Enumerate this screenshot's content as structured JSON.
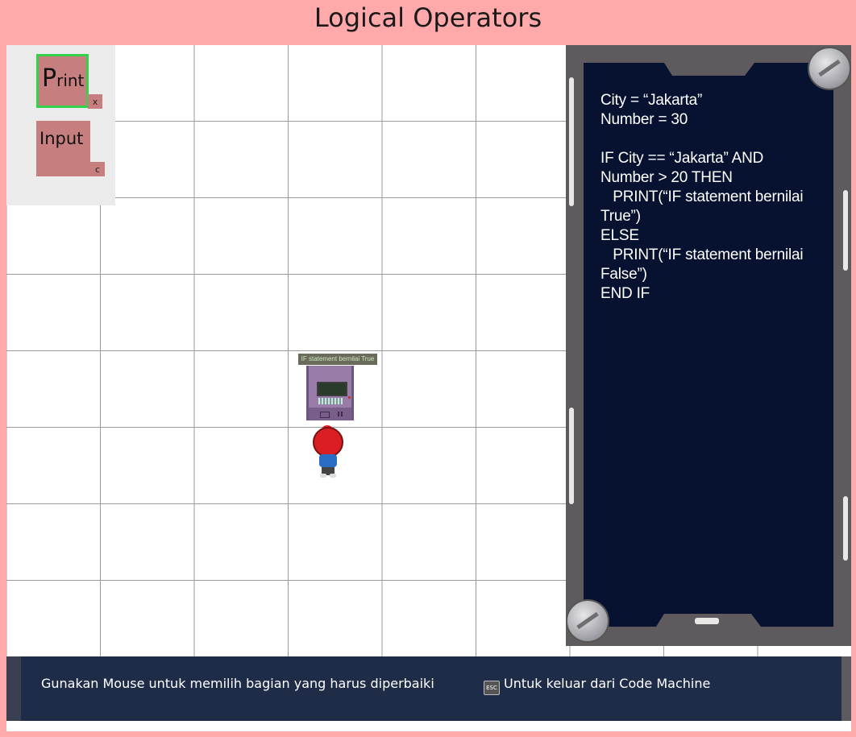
{
  "header": {
    "title": "Logical Operators"
  },
  "palette": {
    "items": [
      {
        "label_first": "P",
        "label_rest": "rint",
        "key": "x",
        "selected": true
      },
      {
        "label": "Input",
        "key": "c",
        "selected": false
      }
    ]
  },
  "code_machine": {
    "code": "City = “Jakarta”\nNumber = 30\n\nIF City == “Jakarta” AND\nNumber > 20 THEN\n   PRINT(“IF statement bernilai\nTrue”)\nELSE\n   PRINT(“IF statement bernilai\nFalse”)\nEND IF"
  },
  "scene": {
    "npc_output": "IF statement bernilai True"
  },
  "footer": {
    "hint_mouse": "Gunakan Mouse untuk memilih bagian yang harus diperbaiki",
    "esc_key": "ESC",
    "hint_esc": "Untuk keluar dari Code Machine"
  },
  "colors": {
    "background": "#ffa9aa",
    "tool": "#c77e7e",
    "selected_border": "#32d24a",
    "screen": "#061230",
    "footer": "#1f2c48"
  }
}
